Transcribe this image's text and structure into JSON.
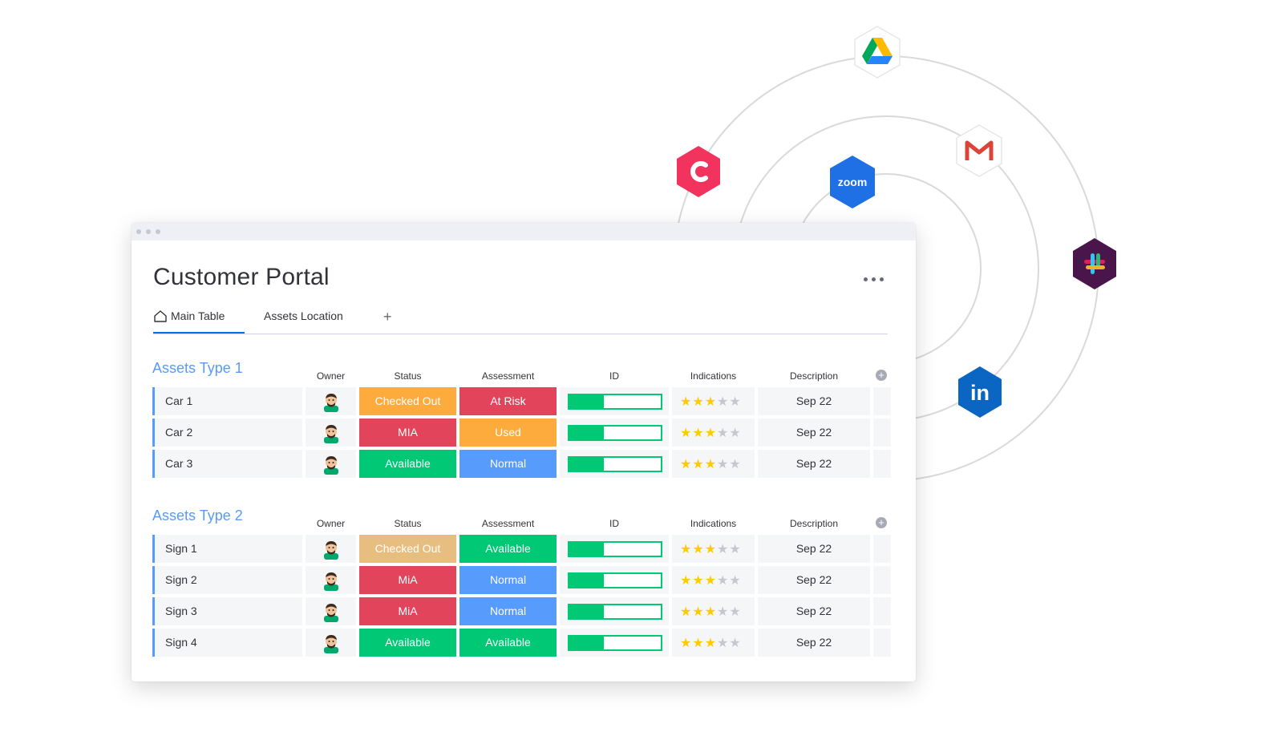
{
  "app": {
    "title": "Customer Portal",
    "tabs": [
      {
        "label": "Main Table",
        "icon": "home-icon",
        "active": true
      },
      {
        "label": "Assets Location",
        "active": false
      }
    ],
    "add_tab_label": "+",
    "more_label": "more-options"
  },
  "columns": [
    "Owner",
    "Status",
    "Assessment",
    "ID",
    "Indications",
    "Description"
  ],
  "add_column_label": "+",
  "colors": {
    "accent": "#579bfc",
    "checked_out": "#fdab3d",
    "checked_out_light": "#e8be80",
    "at_risk": "#e2445c",
    "available": "#00c875",
    "normal": "#579bfc",
    "used": "#fdab3d",
    "star_on": "#ffcb00",
    "star_off": "#c5c7d0"
  },
  "groups": [
    {
      "title": "Assets Type 1",
      "rows": [
        {
          "name": "Car 1",
          "status": "Checked Out",
          "status_color": "#fdab3d",
          "assessment": "At Risk",
          "assessment_color": "#e2445c",
          "id_progress": 0.38,
          "rating": 3,
          "rating_max": 5,
          "description": "Sep 22"
        },
        {
          "name": "Car 2",
          "status": "MIA",
          "status_color": "#e2445c",
          "assessment": "Used",
          "assessment_color": "#fdab3d",
          "id_progress": 0.38,
          "rating": 3,
          "rating_max": 5,
          "description": "Sep 22"
        },
        {
          "name": "Car 3",
          "status": "Available",
          "status_color": "#00c875",
          "assessment": "Normal",
          "assessment_color": "#579bfc",
          "id_progress": 0.38,
          "rating": 3,
          "rating_max": 5,
          "description": "Sep 22"
        }
      ]
    },
    {
      "title": "Assets Type 2",
      "rows": [
        {
          "name": "Sign 1",
          "status": "Checked Out",
          "status_color": "#e8be80",
          "assessment": "Available",
          "assessment_color": "#00c875",
          "id_progress": 0.38,
          "rating": 3,
          "rating_max": 5,
          "description": "Sep 22"
        },
        {
          "name": "Sign 2",
          "status": "MiA",
          "status_color": "#e2445c",
          "assessment": "Normal",
          "assessment_color": "#579bfc",
          "id_progress": 0.38,
          "rating": 3,
          "rating_max": 5,
          "description": "Sep 22"
        },
        {
          "name": "Sign 3",
          "status": "MiA",
          "status_color": "#e2445c",
          "assessment": "Normal",
          "assessment_color": "#579bfc",
          "id_progress": 0.38,
          "rating": 3,
          "rating_max": 5,
          "description": "Sep 22"
        },
        {
          "name": "Sign 4",
          "status": "Available",
          "status_color": "#00c875",
          "assessment": "Available",
          "assessment_color": "#00c875",
          "id_progress": 0.38,
          "rating": 3,
          "rating_max": 5,
          "description": "Sep 22"
        }
      ]
    }
  ],
  "integrations": [
    {
      "name": "google-drive-icon"
    },
    {
      "name": "gmail-icon"
    },
    {
      "name": "caffeine-app-icon"
    },
    {
      "name": "zoom-icon",
      "label": "zoom"
    },
    {
      "name": "slack-icon"
    },
    {
      "name": "linkedin-icon",
      "label": "in"
    }
  ]
}
